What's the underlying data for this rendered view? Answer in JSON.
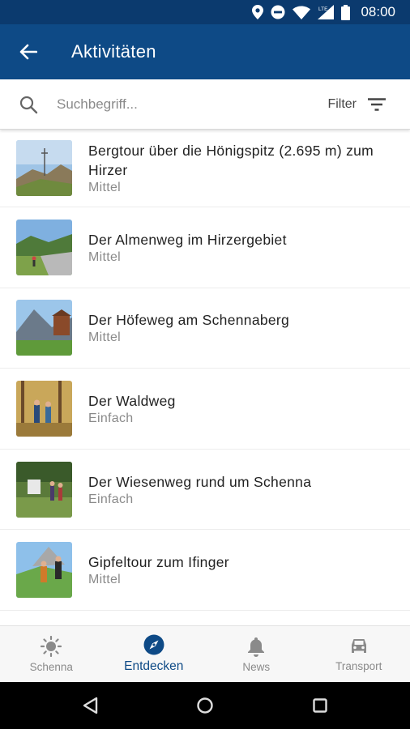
{
  "status": {
    "time": "08:00",
    "network": "LTE"
  },
  "appbar": {
    "title": "Aktivitäten",
    "back_icon": "arrow-left-icon"
  },
  "search": {
    "placeholder": "Suchbegriff...",
    "filter_label": "Filter"
  },
  "activities": [
    {
      "name": "Bergtour über die Hönigspitz (2.695 m) zum Hirzer",
      "level": "Mittel"
    },
    {
      "name": "Der Almenweg im Hirzergebiet",
      "level": "Mittel"
    },
    {
      "name": "Der Höfeweg am Schennaberg",
      "level": "Mittel"
    },
    {
      "name": "Der Waldweg",
      "level": "Einfach"
    },
    {
      "name": "Der Wiesenweg rund um Schenna",
      "level": "Einfach"
    },
    {
      "name": "Gipfeltour zum Ifinger",
      "level": "Mittel"
    }
  ],
  "bottom_nav": [
    {
      "label": "Schenna",
      "icon": "sun-icon"
    },
    {
      "label": "Entdecken",
      "icon": "compass-icon",
      "active": true
    },
    {
      "label": "News",
      "icon": "bell-icon"
    },
    {
      "label": "Transport",
      "icon": "car-icon"
    }
  ],
  "colors": {
    "primary": "#0e4a86",
    "statusbar": "#0b3a6e",
    "inactive": "#8a8a8a"
  }
}
